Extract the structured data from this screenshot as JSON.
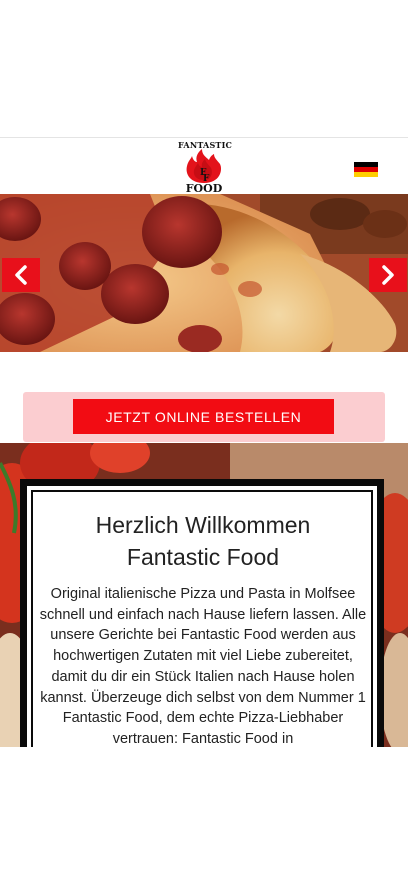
{
  "header": {
    "logo": {
      "top_text": "FANTASTIC",
      "letter_1": "F",
      "letter_2": "F",
      "bottom_text": "FOOD"
    },
    "language_flag": {
      "name": "german-flag-icon",
      "colors": [
        "#000000",
        "#dd0000",
        "#ffce00"
      ]
    }
  },
  "slider": {
    "prev_icon": "chevron-left-icon",
    "next_icon": "chevron-right-icon",
    "accent": "#e8101b"
  },
  "cta": {
    "label": "JETZT ONLINE BESTELLEN",
    "button_color": "#f20c13",
    "band_color": "#fbcdd0"
  },
  "welcome": {
    "title_line1": "Herzlich Willkommen",
    "title_line2": "Fantastic Food",
    "body": "Original italienische Pizza und Pasta in Molfsee schnell und einfach nach Hause liefern lassen. Alle unsere Gerichte bei Fantastic Food werden aus hochwertigen Zutaten mit viel Liebe zubereitet, damit du dir ein Stück Italien nach Hause holen kannst. Überzeuge dich selbst von dem Nummer 1 Fantastic Food, dem echte Pizza-Liebhaber vertrauen: Fantastic Food in"
  }
}
